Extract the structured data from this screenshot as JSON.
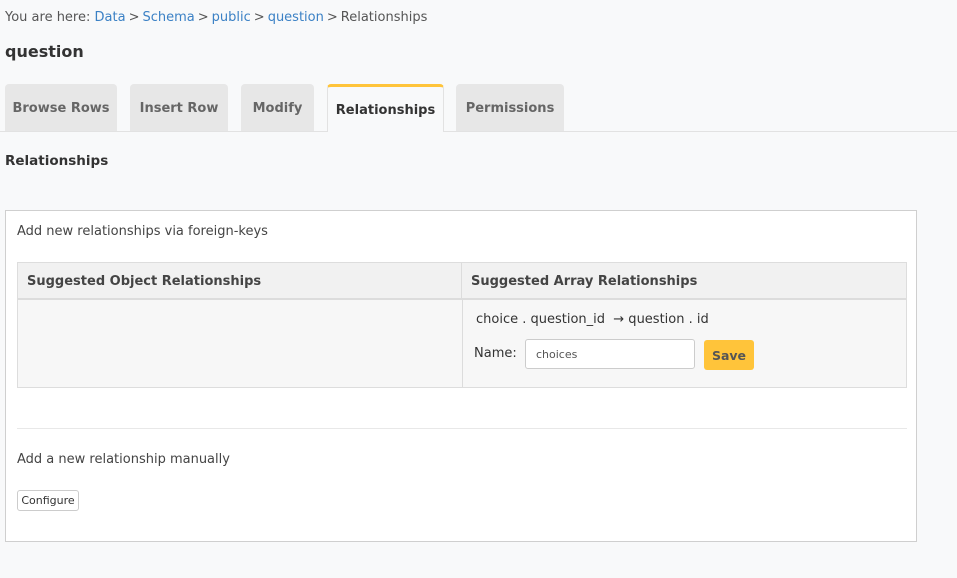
{
  "breadcrumb": {
    "prefix": "You are here:",
    "separator": ">",
    "links": [
      "Data",
      "Schema",
      "public",
      "question"
    ],
    "current": "Relationships"
  },
  "page": {
    "title": "question"
  },
  "tabs": [
    {
      "label": "Browse Rows",
      "active": false
    },
    {
      "label": "Insert Row",
      "active": false
    },
    {
      "label": "Modify",
      "active": false
    },
    {
      "label": "Relationships",
      "active": true
    },
    {
      "label": "Permissions",
      "active": false
    }
  ],
  "section": {
    "title": "Relationships"
  },
  "panel": {
    "fk_label": "Add new relationships via foreign-keys",
    "table": {
      "headers": [
        "Suggested Object Relationships",
        "Suggested Array Relationships"
      ],
      "object_relationships": [],
      "array_relationships": [
        {
          "mapping": "choice . question_id  → question . id",
          "name_label": "Name:",
          "name_value": "choices",
          "save_label": "Save"
        }
      ]
    },
    "manual_label": "Add a new relationship manually",
    "configure_label": "Configure"
  },
  "colors": {
    "accent": "#ffc43a",
    "link": "#3b81c5",
    "background": "#f8f9fa"
  }
}
